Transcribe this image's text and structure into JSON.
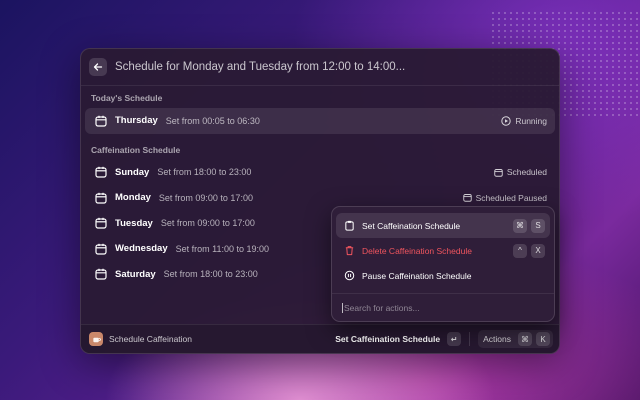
{
  "header": {
    "title": "Schedule for Monday and Tuesday from 12:00 to 14:00..."
  },
  "today": {
    "title": "Today's Schedule",
    "item": {
      "day": "Thursday",
      "desc": "Set from 00:05 to 06:30",
      "status": "Running"
    }
  },
  "caffeination": {
    "title": "Caffeination Schedule",
    "items": [
      {
        "day": "Sunday",
        "desc": "Set from 18:00 to 23:00",
        "status": "Scheduled"
      },
      {
        "day": "Monday",
        "desc": "Set from 09:00 to 17:00",
        "status": "Scheduled Paused"
      },
      {
        "day": "Tuesday",
        "desc": "Set from 09:00 to 17:00",
        "status": ""
      },
      {
        "day": "Wednesday",
        "desc": "Set from 11:00 to 19:00",
        "status": ""
      },
      {
        "day": "Saturday",
        "desc": "Set from 18:00 to 23:00",
        "status": ""
      }
    ]
  },
  "actions_panel": {
    "items": [
      {
        "label": "Set Caffeination Schedule",
        "icon": "clipboard-icon",
        "keys": [
          "⌘",
          "S"
        ]
      },
      {
        "label": "Delete Caffeination Schedule",
        "icon": "trash-icon",
        "keys": [
          "^",
          "X"
        ]
      },
      {
        "label": "Pause Caffeination Schedule",
        "icon": "pause-icon",
        "keys": []
      }
    ],
    "search_placeholder": "Search for actions..."
  },
  "footer": {
    "app_title": "Schedule Caffeination",
    "primary_action": "Set Caffeination Schedule",
    "primary_key": "↵",
    "actions_label": "Actions",
    "actions_keys": [
      "⌘",
      "K"
    ]
  },
  "colors": {
    "danger": "#f0555e",
    "window_bg": "#2a1a34"
  }
}
